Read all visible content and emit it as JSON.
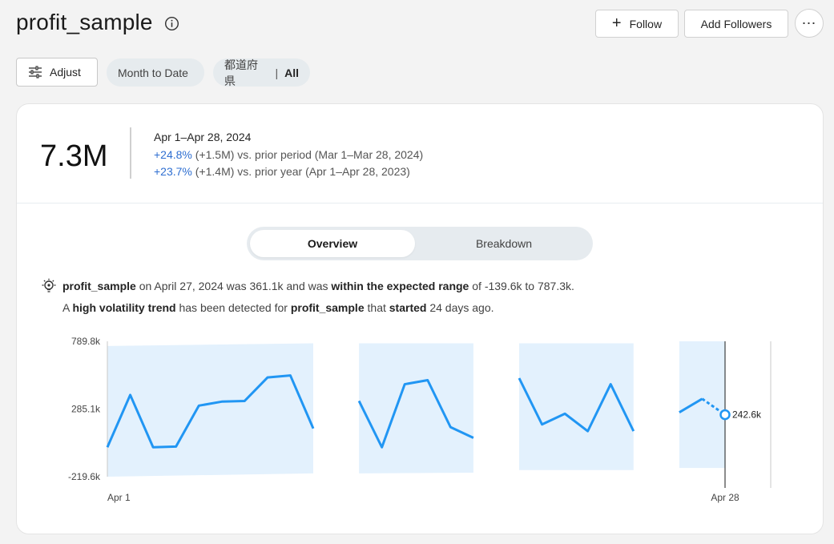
{
  "header": {
    "title": "profit_sample",
    "follow_label": "Follow",
    "followers_label": "Add Followers",
    "more_label": "⋯"
  },
  "filters": {
    "adjust_label": "Adjust",
    "date_chip": "Month to Date",
    "pref_chip_name": "都道府県",
    "pref_chip_sep": "|",
    "pref_chip_value": "All"
  },
  "kpi": {
    "value": "7.3M",
    "period": "Apr 1–Apr 28, 2024",
    "prior_period_pct": "+24.8%",
    "prior_period_rest": " (+1.5M) vs. prior period (Mar 1–Mar 28, 2024)",
    "prior_year_pct": "+23.7%",
    "prior_year_rest": " (+1.4M) vs. prior year (Apr 1–Apr 28, 2023)"
  },
  "tabs": {
    "overview": "Overview",
    "breakdown": "Breakdown"
  },
  "insight": {
    "l1_a": "profit_sample",
    "l1_b": " on April 27, 2024 was 361.1k and was ",
    "l1_c": "within the expected range",
    "l1_d": " of -139.6k to 787.3k.",
    "l2_a": "A ",
    "l2_b": "high volatility trend",
    "l2_c": " has been detected for ",
    "l2_d": "profit_sample",
    "l2_e": " that ",
    "l2_f": "started",
    "l2_g": " 24 days ago."
  },
  "chart_data": {
    "type": "line",
    "x": [
      "Apr 1",
      "Apr 2",
      "Apr 3",
      "Apr 4",
      "Apr 5",
      "Apr 6",
      "Apr 7",
      "Apr 8",
      "Apr 9",
      "Apr 10",
      "Apr 12",
      "Apr 13",
      "Apr 14",
      "Apr 15",
      "Apr 16",
      "Apr 17",
      "Apr 19",
      "Apr 20",
      "Apr 21",
      "Apr 22",
      "Apr 23",
      "Apr 24",
      "Apr 26",
      "Apr 27",
      "Apr 28"
    ],
    "series": [
      {
        "values": [
          0,
          390,
          0,
          5,
          310,
          340,
          345,
          520,
          535,
          140,
          345,
          0,
          470,
          500,
          150,
          70,
          515,
          170,
          250,
          120,
          470,
          120,
          260,
          361,
          242.6
        ],
        "segment_starts": [
          0,
          10,
          16,
          22
        ],
        "forecast_from_index": 23
      }
    ],
    "expected_range_band": [
      {
        "from": "Apr 1",
        "to": "Apr 10",
        "low": [
          -219.6,
          -195
        ],
        "high": [
          755,
          775
        ]
      },
      {
        "from": "Apr 12",
        "to": "Apr 17",
        "low": [
          -195,
          -190
        ],
        "high": [
          775,
          775
        ]
      },
      {
        "from": "Apr 19",
        "to": "Apr 24",
        "low": [
          -170,
          -170
        ],
        "high": [
          775,
          775
        ]
      },
      {
        "from": "Apr 26",
        "to": "Apr 28",
        "low": [
          -155,
          -155
        ],
        "high": [
          789.8,
          789.8
        ]
      }
    ],
    "yticks": [
      "789.8k",
      "285.1k",
      "-219.6k"
    ],
    "ylim": [
      -219.6,
      789.8
    ],
    "xticks": [
      "Apr 1",
      "Apr 28"
    ],
    "highlight_label": "242.6k",
    "colors": {
      "line": "#2196f3",
      "band": "#e3f1fd",
      "axis": "#c8c8c8",
      "marker_line": "#1a1a1a"
    }
  }
}
